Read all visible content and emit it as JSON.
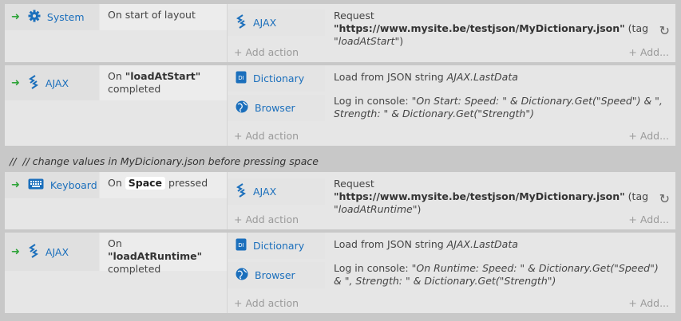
{
  "events": [
    {
      "object": "System",
      "condition": "On start of layout",
      "action_object": "AJAX",
      "action_desc_prefix": "Request ",
      "url": "\"https://www.mysite.be/testjson/MyDictionary.json\"",
      "tag_prefix": " (tag ",
      "tag": "\"loadAtStart\"",
      "tag_suffix": ")"
    },
    {
      "object": "AJAX",
      "condition_prefix": "On ",
      "condition_tag": "\"loadAtStart\"",
      "condition_suffix": "completed",
      "actions": [
        {
          "object": "Dictionary",
          "desc_prefix": "Load from JSON string ",
          "desc_expr": "AJAX.LastData"
        },
        {
          "object": "Browser",
          "desc_prefix": "Log in console: ",
          "desc_expr": "\"On Start: Speed: \" & Dictionary.Get(\"Speed\") & \", Strength: \" & Dictionary.Get(\"Strength\")"
        }
      ]
    },
    {
      "object": "Keyboard",
      "condition_prefix": "On",
      "key": "Space",
      "condition_suffix": "pressed",
      "action_object": "AJAX",
      "action_desc_prefix": "Request ",
      "url": "\"https://www.mysite.be/testjson/MyDictionary.json\"",
      "tag_prefix": " (tag ",
      "tag": "\"loadAtRuntime\"",
      "tag_suffix": ")"
    },
    {
      "object": "AJAX",
      "condition_prefix": "On ",
      "condition_tag": "\"loadAtRuntime\"",
      "condition_suffix": "completed",
      "actions": [
        {
          "object": "Dictionary",
          "desc_prefix": "Load from JSON string ",
          "desc_expr": "AJAX.LastData"
        },
        {
          "object": "Browser",
          "desc_prefix": "Log in console: ",
          "desc_expr": "\"On Runtime: Speed: \" & Dictionary.Get(\"Speed\") & \", Strength: \" & Dictionary.Get(\"Strength\")"
        }
      ]
    }
  ],
  "comment": "// change values in MyDicionary.json before pressing space",
  "comment_marker": "//",
  "add_action_label": "+ Add action",
  "add_more_label": "+ Add...",
  "colors": {
    "link": "#1b6fbc",
    "arrow": "#2fa43a",
    "background": "#c8c8c8"
  }
}
